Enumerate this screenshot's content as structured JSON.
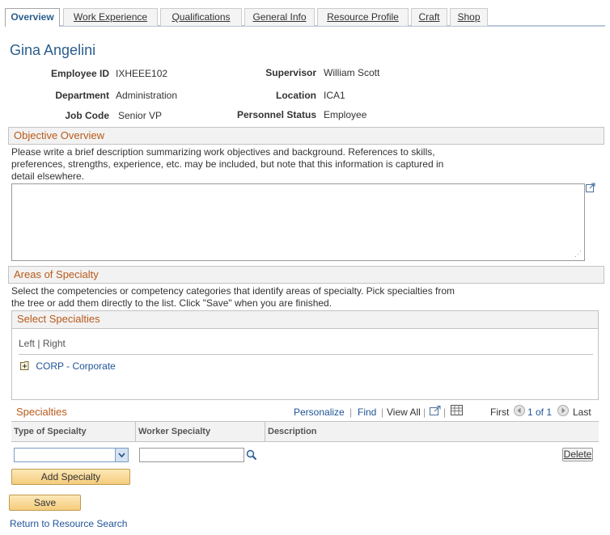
{
  "tabs": [
    {
      "label": "Overview",
      "active": true
    },
    {
      "label": "Work Experience"
    },
    {
      "label": "Qualifications"
    },
    {
      "label": "General Info"
    },
    {
      "label": "Resource Profile"
    },
    {
      "label": "Craft"
    },
    {
      "label": "Shop"
    }
  ],
  "employee": {
    "name": "Gina Angelini",
    "employee_id_label": "Employee ID",
    "employee_id": "IXHEEE102",
    "supervisor_label": "Supervisor",
    "supervisor": "William Scott",
    "department_label": "Department",
    "department": "Administration",
    "location_label": "Location",
    "location": "ICA1",
    "job_code_label": "Job Code",
    "job_code": "Senior VP",
    "personnel_status_label": "Personnel Status",
    "personnel_status": "Employee"
  },
  "objective": {
    "header": "Objective Overview",
    "line1": "Please write a brief description summarizing work objectives and background. References to skills,",
    "line2": "preferences, strengths, experience, etc. may be included, but note that this information is captured in",
    "line3": "detail elsewhere.",
    "value": ""
  },
  "specialty": {
    "header": "Areas of Specialty",
    "line1": "Select the competencies or competency categories that identify areas of specialty. Pick specialties from",
    "line2": "the tree or add them directly to the list. Click \"Save\" when you are finished.",
    "select_header": "Select Specialties",
    "left": "Left",
    "separator": "|",
    "right": "Right",
    "tree_node": "CORP - Corporate"
  },
  "grid": {
    "title": "Specialties",
    "personalize": "Personalize",
    "find": "Find",
    "view_all": "View All",
    "first": "First",
    "range": "1 of 1",
    "last": "Last",
    "col_type": "Type of Specialty",
    "col_worker": "Worker Specialty",
    "col_desc": "Description",
    "type_value": "",
    "worker_value": "",
    "delete": "Delete"
  },
  "buttons": {
    "add_specialty": "Add Specialty",
    "save": "Save",
    "return": "Return to Resource Search"
  },
  "colors": {
    "accent": "#2b5d8c",
    "section_title": "#b85a1a",
    "button": "#f4cc7c"
  }
}
